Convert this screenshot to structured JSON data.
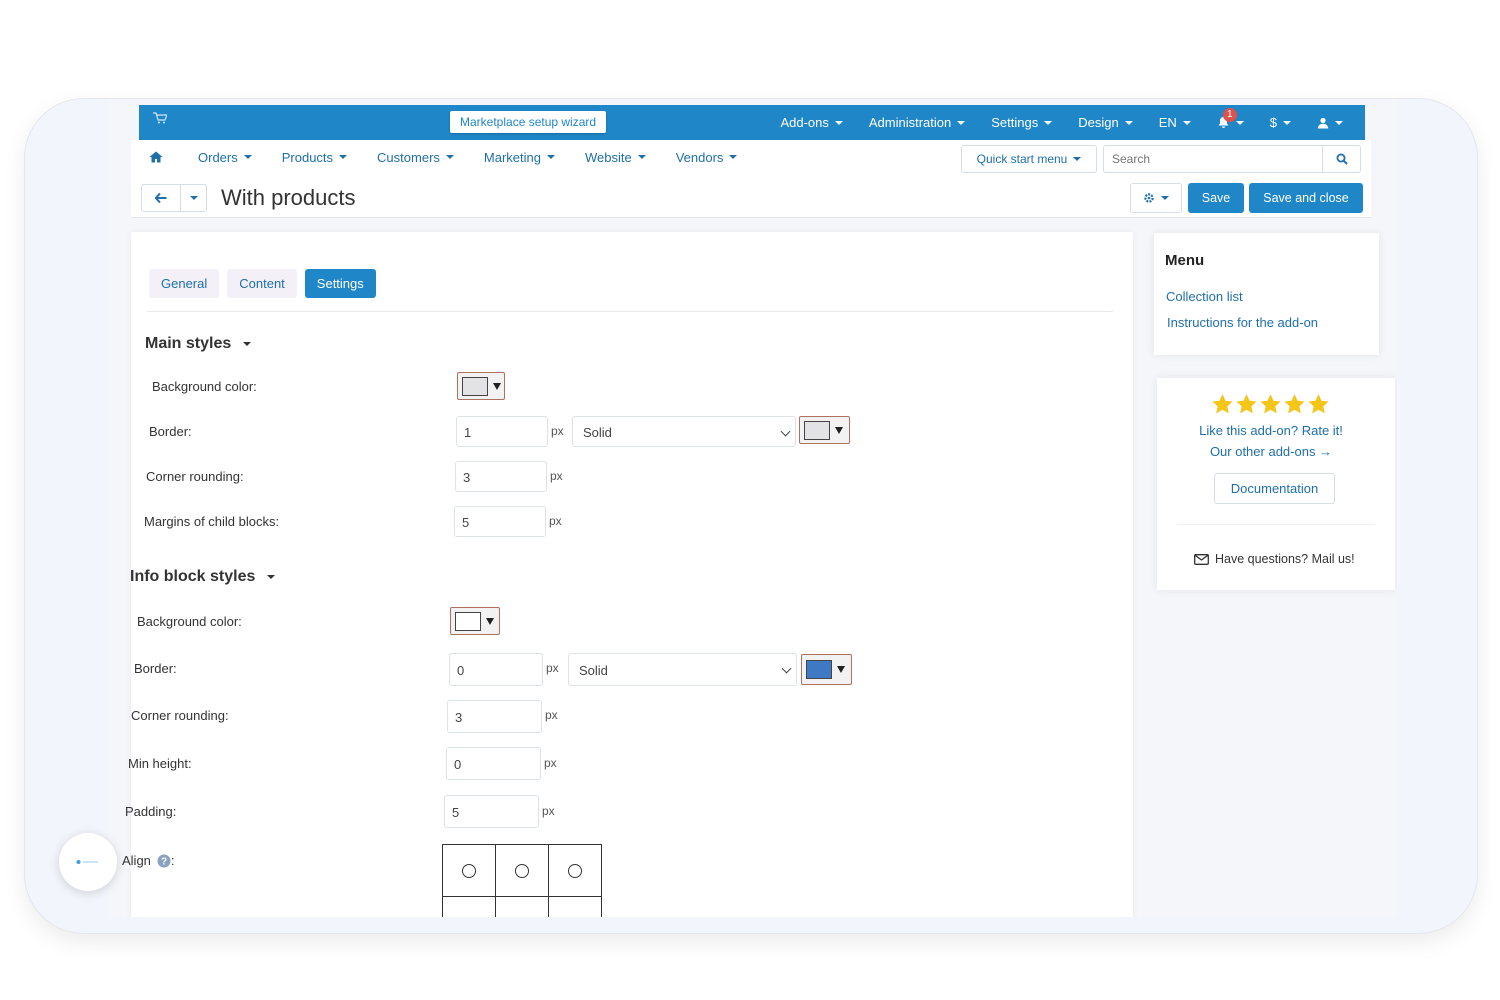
{
  "header": {
    "wizard_label": "Marketplace setup wizard",
    "top_menu": [
      "Add-ons",
      "Administration",
      "Settings",
      "Design",
      "EN"
    ],
    "notification_count": "1",
    "currency": "$"
  },
  "menu": {
    "items": [
      "Orders",
      "Products",
      "Customers",
      "Marketing",
      "Website",
      "Vendors"
    ],
    "quick_start": "Quick start menu",
    "search_placeholder": "Search"
  },
  "page": {
    "title": "With products",
    "save": "Save",
    "save_close": "Save and close"
  },
  "tabs": [
    "General",
    "Content",
    "Settings"
  ],
  "active_tab": "Settings",
  "main_styles": {
    "heading": "Main styles",
    "bg_label": "Background color:",
    "bg_color": "#e3e3e5",
    "border_label": "Border:",
    "border_width": "1",
    "border_style": "Solid",
    "border_color": "#e3e3e5",
    "rounding_label": "Corner rounding:",
    "rounding": "3",
    "margins_label": "Margins of child blocks:",
    "margins": "5",
    "unit": "px"
  },
  "info_styles": {
    "heading": "Info block styles",
    "bg_label": "Background color:",
    "bg_color": "#ffffff",
    "border_label": "Border:",
    "border_width": "0",
    "border_style": "Solid",
    "border_color": "#3e7ac4",
    "rounding_label": "Corner rounding:",
    "rounding": "3",
    "min_height_label": "Min height:",
    "min_height": "0",
    "padding_label": "Padding:",
    "padding": "5",
    "align_label": "Align",
    "align_colon": ":",
    "unit": "px"
  },
  "sidebar": {
    "menu_title": "Menu",
    "links": [
      "Collection list",
      "Instructions for the add-on"
    ],
    "rate_text": "Like this add-on? Rate it!",
    "other_addons": "Our other add-ons →",
    "documentation": "Documentation",
    "mail_text": "Have questions? Mail us!",
    "star_color": "#f5c518",
    "star_rating": 5
  },
  "colors": {
    "primary": "#1f86c8",
    "link": "#1f6fab"
  }
}
